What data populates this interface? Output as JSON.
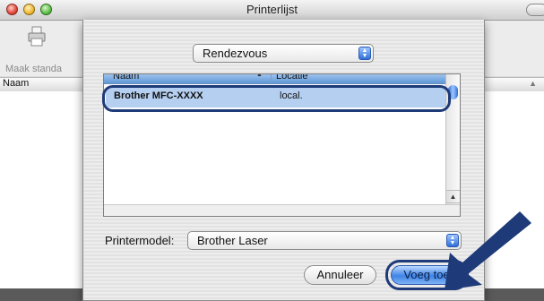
{
  "window": {
    "title": "Printerlijst"
  },
  "toolbar": {
    "make_default_label": "Maak standa"
  },
  "list": {
    "column_name": "Naam",
    "column_arrow": "▲"
  },
  "sheet": {
    "connection_popup": {
      "selected": "Rendezvous"
    },
    "table": {
      "col_name": "Naam",
      "col_location": "Locatie",
      "rows": [
        {
          "name": "Brother MFC-XXXX",
          "location": "local."
        }
      ]
    },
    "printer_model": {
      "label": "Printermodel:",
      "selected": "Brother Laser"
    },
    "buttons": {
      "cancel": "Annuleer",
      "add": "Voeg toe"
    }
  },
  "colors": {
    "accent": "#3f84e6",
    "highlight": "#1e3a78",
    "selection": "#b5cff0"
  },
  "icons": [
    "close-icon",
    "minimize-icon",
    "zoom-icon",
    "printer-icon",
    "popup-arrows-icon",
    "pointer-arrow-icon"
  ]
}
